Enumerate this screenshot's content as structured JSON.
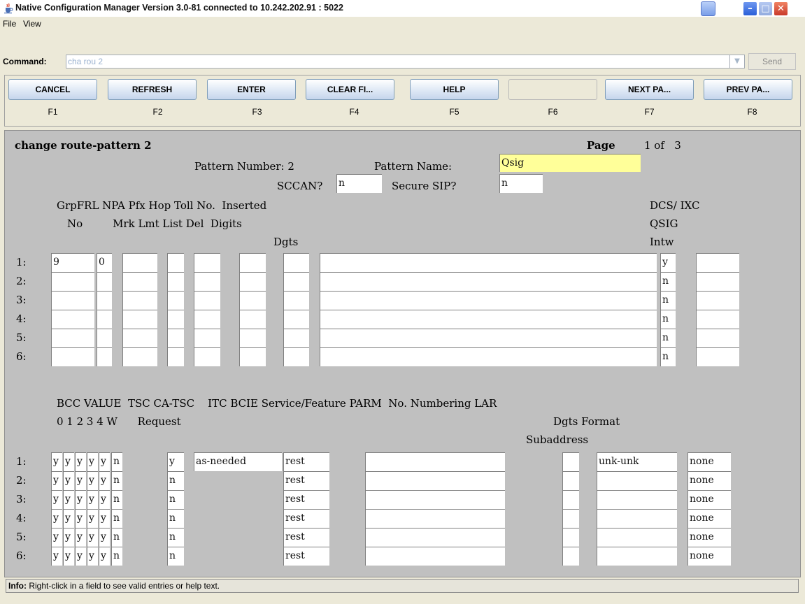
{
  "window": {
    "title": "Native Configuration Manager Version 3.0-81 connected to 10.242.202.91 : 5022"
  },
  "menu": [
    "File",
    "View"
  ],
  "command": {
    "label": "Command:",
    "value": "cha rou 2",
    "send_label": "Send"
  },
  "function_keys": [
    {
      "label": "CANCEL",
      "key": "F1"
    },
    {
      "label": "REFRESH",
      "key": "F2"
    },
    {
      "label": "ENTER",
      "key": "F3"
    },
    {
      "label": "CLEAR FI...",
      "key": "F4"
    },
    {
      "label": "HELP",
      "key": "F5"
    },
    {
      "label": "",
      "key": "F6"
    },
    {
      "label": "NEXT PA...",
      "key": "F7"
    },
    {
      "label": "PREV PA...",
      "key": "F8"
    }
  ],
  "screen": {
    "heading": "change route-pattern 2",
    "page_label": "Page",
    "page_value": "1 of   3",
    "pattern_number_label": "Pattern Number: 2",
    "pattern_name_label": "Pattern Name:",
    "pattern_name": "Qsig",
    "sccan_label": "SCCAN?",
    "sccan": "n",
    "secure_sip_label": "Secure SIP?",
    "secure_sip": "n",
    "upper_headers": {
      "line1": "GrpFRL NPA Pfx Hop Toll No.  Inserted",
      "line2": "No         Mrk Lmt List Del  Digits",
      "line3": "Dgts",
      "dcs_line1": "DCS/ IXC",
      "dcs_line2": "QSIG",
      "dcs_line3": "Intw"
    },
    "upper_rows": [
      {
        "num": "1:",
        "grp": "9",
        "frl": "0",
        "qsig": "y"
      },
      {
        "num": "2:",
        "grp": "",
        "frl": "",
        "qsig": "n"
      },
      {
        "num": "3:",
        "grp": "",
        "frl": "",
        "qsig": "n"
      },
      {
        "num": "4:",
        "grp": "",
        "frl": "",
        "qsig": "n"
      },
      {
        "num": "5:",
        "grp": "",
        "frl": "",
        "qsig": "n"
      },
      {
        "num": "6:",
        "grp": "",
        "frl": "",
        "qsig": "n"
      }
    ],
    "lower_headers": {
      "line1": "BCC VALUE  TSC CA-TSC    ITC BCIE Service/Feature PARM  No. Numbering LAR",
      "line2": "0 1 2 3 4 W      Request",
      "line2b": "Dgts Format",
      "line3": "Subaddress"
    },
    "lower_rows": [
      {
        "num": "1:",
        "bcc": [
          "y",
          "y",
          "y",
          "y",
          "y",
          "n"
        ],
        "tsc": "y",
        "ca_tsc": "as-needed",
        "itc": "rest",
        "numbering": "unk-unk",
        "lar": "none"
      },
      {
        "num": "2:",
        "bcc": [
          "y",
          "y",
          "y",
          "y",
          "y",
          "n"
        ],
        "tsc": "n",
        "ca_tsc": "",
        "itc": "rest",
        "numbering": "",
        "lar": "none"
      },
      {
        "num": "3:",
        "bcc": [
          "y",
          "y",
          "y",
          "y",
          "y",
          "n"
        ],
        "tsc": "n",
        "ca_tsc": "",
        "itc": "rest",
        "numbering": "",
        "lar": "none"
      },
      {
        "num": "4:",
        "bcc": [
          "y",
          "y",
          "y",
          "y",
          "y",
          "n"
        ],
        "tsc": "n",
        "ca_tsc": "",
        "itc": "rest",
        "numbering": "",
        "lar": "none"
      },
      {
        "num": "5:",
        "bcc": [
          "y",
          "y",
          "y",
          "y",
          "y",
          "n"
        ],
        "tsc": "n",
        "ca_tsc": "",
        "itc": "rest",
        "numbering": "",
        "lar": "none"
      },
      {
        "num": "6:",
        "bcc": [
          "y",
          "y",
          "y",
          "y",
          "y",
          "n"
        ],
        "tsc": "n",
        "ca_tsc": "",
        "itc": "rest",
        "numbering": "",
        "lar": "none"
      }
    ]
  },
  "info": {
    "label": "Info:",
    "text": "Right-click in a field to see valid entries or help text."
  },
  "icons": {
    "app": "java-cup-icon",
    "minimize": "minimize-icon",
    "maximize": "maximize-icon",
    "close": "close-icon",
    "dropdown": "chevron-down-icon"
  }
}
